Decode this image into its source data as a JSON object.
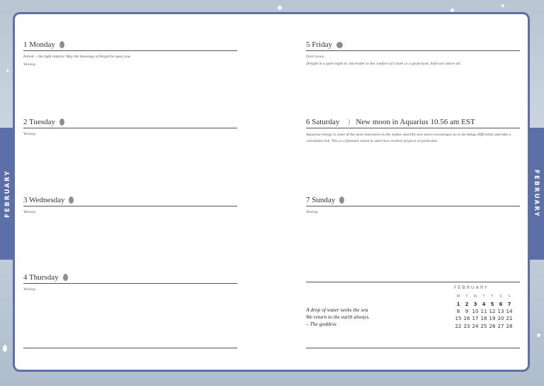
{
  "month_tab": "FEBRUARY",
  "left_days": [
    {
      "title": "1 Monday",
      "moon": "gibbous",
      "note": "Imbolc – the light returns! May the blessings of Brigid be upon you.",
      "phase": "Waning"
    },
    {
      "title": "2 Tuesday",
      "moon": "gibbous",
      "note": "",
      "phase": "Waning"
    },
    {
      "title": "3 Wednesday",
      "moon": "gibbous",
      "note": "",
      "phase": "Waning"
    },
    {
      "title": "4 Thursday",
      "moon": "gibbous",
      "note": "",
      "phase": "Waning"
    }
  ],
  "right_days": [
    {
      "title": "5 Friday",
      "moon": "full",
      "event": "",
      "note": "Dark moon",
      "note2": "Delight in a quiet night in. Surrender to the comfort of a bath or a good book. Self-care above all."
    },
    {
      "title": "6 Saturday",
      "moon": "crescent",
      "event": "New moon in Aquarius 10.56 am EST",
      "note": "Aquarius energy is some of the most innovative in the zodiac and this new moon encourages us to do things differently and take a calculated risk. This is a fantastic moon to start new creative projects in particular.",
      "note2": ""
    },
    {
      "title": "7 Sunday",
      "moon": "gibbous",
      "event": "",
      "note": "Waxing",
      "note2": ""
    }
  ],
  "quote": {
    "line1": "A drop of water seeks the sea",
    "line2": "We return to the earth always.",
    "line3": "– The goddess"
  },
  "calendar": {
    "month": "FEBRUARY",
    "weekdays": [
      "M",
      "T",
      "W",
      "T",
      "F",
      "S",
      "S"
    ],
    "weeks": [
      [
        "1",
        "2",
        "3",
        "4",
        "5",
        "6",
        "7"
      ],
      [
        "8",
        "9",
        "10",
        "11",
        "12",
        "13",
        "14"
      ],
      [
        "15",
        "16",
        "17",
        "18",
        "19",
        "20",
        "21"
      ],
      [
        "22",
        "23",
        "24",
        "25",
        "26",
        "27",
        "28"
      ]
    ]
  }
}
